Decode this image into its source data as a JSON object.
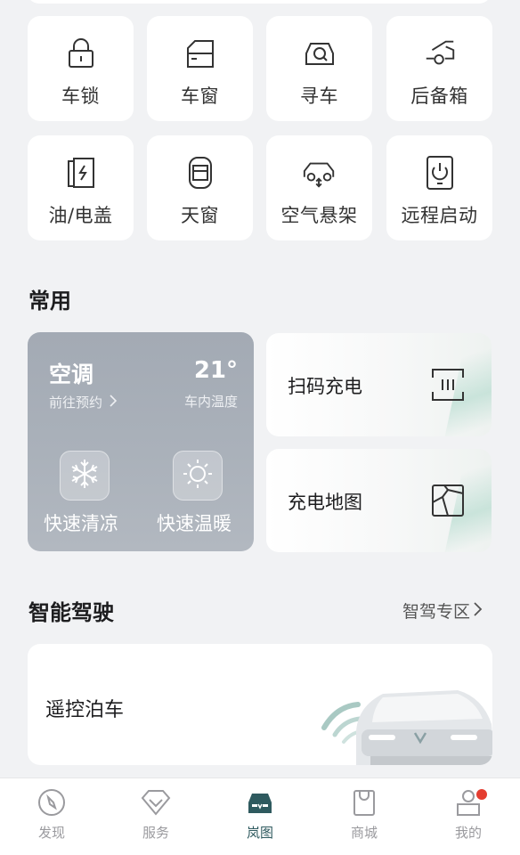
{
  "controls": {
    "lock": "车锁",
    "window": "车窗",
    "find_car": "寻车",
    "trunk": "后备箱",
    "fuel_cover": "油/电盖",
    "sunroof": "天窗",
    "air_suspension": "空气悬架",
    "remote_start": "远程启动"
  },
  "common": {
    "title": "常用",
    "ac": {
      "title": "空调",
      "sub": "前往预约",
      "temp": "21°",
      "temp_label": "车内温度",
      "quick_cool": "快速清凉",
      "quick_warm": "快速温暖"
    },
    "scan_charge": "扫码充电",
    "charge_map": "充电地图"
  },
  "smart_drive": {
    "title": "智能驾驶",
    "zone_link": "智驾专区",
    "remote_parking": "遥控泊车"
  },
  "tabs": {
    "discover": "发现",
    "service": "服务",
    "lantu": "岚图",
    "mall": "商城",
    "mine": "我的"
  },
  "colors": {
    "active_tab": "#2f5a5f",
    "badge": "#e43d30",
    "ac_card": "#a7aeb7"
  }
}
